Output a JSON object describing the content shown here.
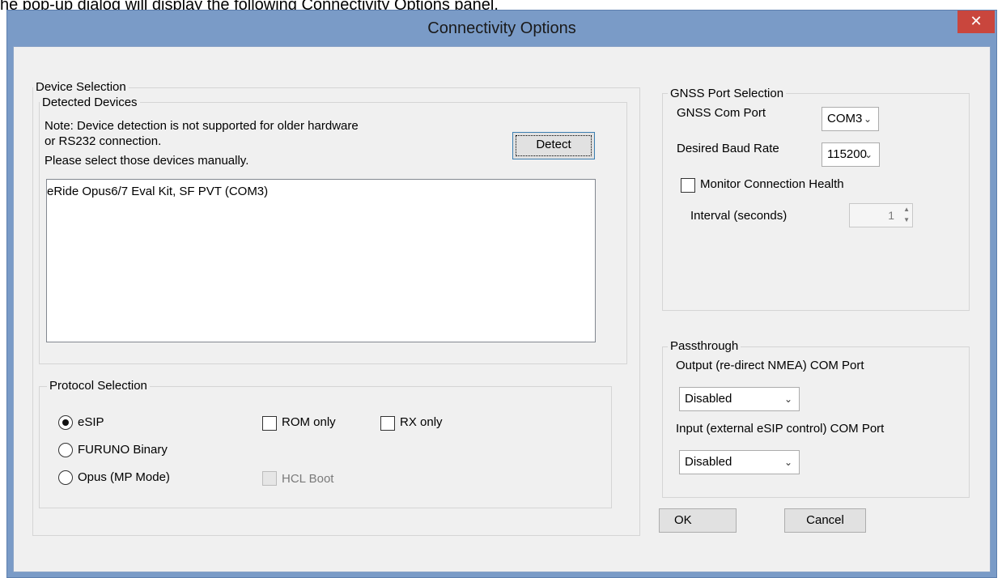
{
  "page_caption": "he pop-up dialog will display the following Connectivity Options panel.",
  "window": {
    "title": "Connectivity Options",
    "close_glyph": "✕"
  },
  "device_selection": {
    "legend": "Device Selection",
    "detected": {
      "legend": "Detected Devices",
      "note_lines": [
        "Note: Device detection is not supported for older hardware",
        "or RS232 connection.",
        "Please select those devices manually."
      ],
      "detect_button": "Detect",
      "devices": [
        "eRide Opus6/7 Eval Kit, SF PVT (COM3)"
      ]
    }
  },
  "protocol": {
    "legend": "Protocol Selection",
    "radios": [
      {
        "label": "eSIP",
        "selected": true
      },
      {
        "label": "FURUNO Binary",
        "selected": false
      },
      {
        "label": "Opus (MP Mode)",
        "selected": false
      }
    ],
    "checks": {
      "rom_only": "ROM only",
      "rx_only": "RX only",
      "hcl_boot": "HCL Boot"
    }
  },
  "gnss": {
    "legend": "GNSS Port Selection",
    "com_port_label": "GNSS Com Port",
    "com_port_value": "COM3",
    "baud_label": "Desired Baud Rate",
    "baud_value": "115200",
    "monitor_label": "Monitor Connection Health",
    "interval_label": "Interval (seconds)",
    "interval_value": "1"
  },
  "passthrough": {
    "legend": "Passthrough",
    "output_label": "Output (re-direct NMEA) COM Port",
    "output_value": "Disabled",
    "input_label": "Input (external eSIP control) COM Port",
    "input_value": "Disabled"
  },
  "buttons": {
    "ok": "OK",
    "cancel": "Cancel"
  },
  "icons": {
    "dropdown": "chevron-down-icon",
    "spin_up": "▲",
    "spin_down": "▼",
    "chevron": "⌄"
  }
}
